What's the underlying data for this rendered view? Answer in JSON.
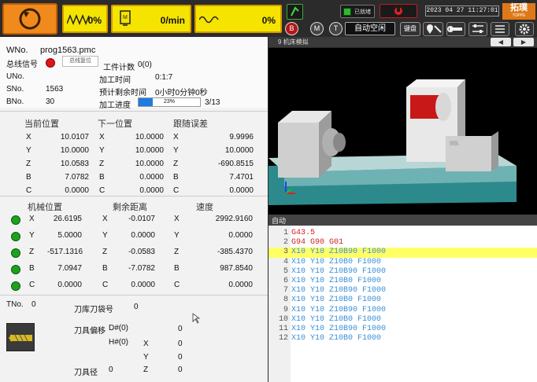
{
  "top": {
    "feed_pct": "0%",
    "spindle_speed": "0/min",
    "rapid_pct": "0%",
    "connected_label": "已就绪",
    "datetime": "2023 04 27  11:27:01",
    "brand": "拓璞",
    "brand_sub": "TOPPE",
    "mode_label": "自动空闲",
    "keyboard_label": "键盘"
  },
  "program": {
    "wno_label": "WNo.",
    "wno_value": "prog1563.pmc",
    "bus_label": "总线信号",
    "bus_button": "总线复位",
    "workcount_label": "工件计数",
    "workcount_value": "0(0)",
    "uno_label": "UNo.",
    "proc_time_label": "加工时间",
    "proc_time_value": "0:1:7",
    "sno_label": "SNo.",
    "sno_value": "1563",
    "remain_label": "预计剩余时间",
    "remain_value": "0小时0分钟0秒",
    "bno_label": "BNo.",
    "bno_value": "30",
    "progress_label": "加工进度",
    "progress_pct": 23,
    "progress_text": "23%",
    "progress_count": "3/13"
  },
  "positions": {
    "current_title": "当前位置",
    "next_title": "下一位置",
    "follow_title": "跟随误差",
    "axes": [
      "X",
      "Y",
      "Z",
      "B",
      "C"
    ],
    "current": [
      "10.0107",
      "10.0000",
      "10.0583",
      "7.0782",
      "0.0000"
    ],
    "next": [
      "10.0000",
      "10.0000",
      "10.0000",
      "0.0000",
      "0.0000"
    ],
    "follow": [
      "9.9996",
      "10.0000",
      "-690.8515",
      "7.4701",
      "0.0000"
    ]
  },
  "machine": {
    "mpos_title": "机械位置",
    "remain_title": "剩余距离",
    "speed_title": "速度",
    "mpos": [
      "26.6195",
      "5.0000",
      "-517.1316",
      "7.0947",
      "0.0000"
    ],
    "remain": [
      "-0.0107",
      "0.0000",
      "-0.0583",
      "-7.0782",
      "0.0000"
    ],
    "speed": [
      "2992.9160",
      "0.0000",
      "-385.4370",
      "987.8540",
      "0.0000"
    ]
  },
  "tool": {
    "tno_label": "TNo.",
    "tno_value": "0",
    "magazine_label": "刀库刀袋号",
    "magazine_value": "0",
    "offset_label": "刀具偏移",
    "d_label": "D#(0)",
    "d_value": "0",
    "h_label": "H#(0)",
    "x_label": "X",
    "x_value": "0",
    "y_label": "Y",
    "y_value": "0",
    "radius_label": "刀具径",
    "radius_value": "0",
    "z_label": "Z",
    "z_value": "0"
  },
  "sim": {
    "title": "9 机床模拟"
  },
  "code": {
    "title": "自动",
    "lines": [
      {
        "n": "1",
        "text": "G43.5",
        "color": "#d02020"
      },
      {
        "n": "2",
        "text": "G94 G90 G01",
        "color": "#d02020"
      },
      {
        "n": "3",
        "text": "X10 Y10 Z10B90 F1000",
        "color": "#3a8fd8"
      },
      {
        "n": "4",
        "text": "X10 Y10 Z10B0 F1000",
        "color": "#3a8fd8"
      },
      {
        "n": "5",
        "text": "X10 Y10 Z10B90 F1000",
        "color": "#3a8fd8"
      },
      {
        "n": "6",
        "text": "X10 Y10 Z10B0 F1000",
        "color": "#3a8fd8"
      },
      {
        "n": "7",
        "text": "X10 Y10 Z10B90 F1000",
        "color": "#3a8fd8"
      },
      {
        "n": "8",
        "text": "X10 Y10 Z10B0 F1000",
        "color": "#3a8fd8"
      },
      {
        "n": "9",
        "text": "X10 Y10 Z10B90 F1000",
        "color": "#3a8fd8"
      },
      {
        "n": "10",
        "text": "X10 Y10 Z10B0 F1000",
        "color": "#3a8fd8"
      },
      {
        "n": "11",
        "text": "X10 Y10 Z10B90 F1000",
        "color": "#3a8fd8"
      },
      {
        "n": "12",
        "text": "X10 Y10 Z10B0 F1000",
        "color": "#3a8fd8"
      }
    ]
  },
  "colors": {
    "accent_yellow": "#f5e400",
    "highlight": "#ffff66",
    "green": "#1fa11f"
  }
}
